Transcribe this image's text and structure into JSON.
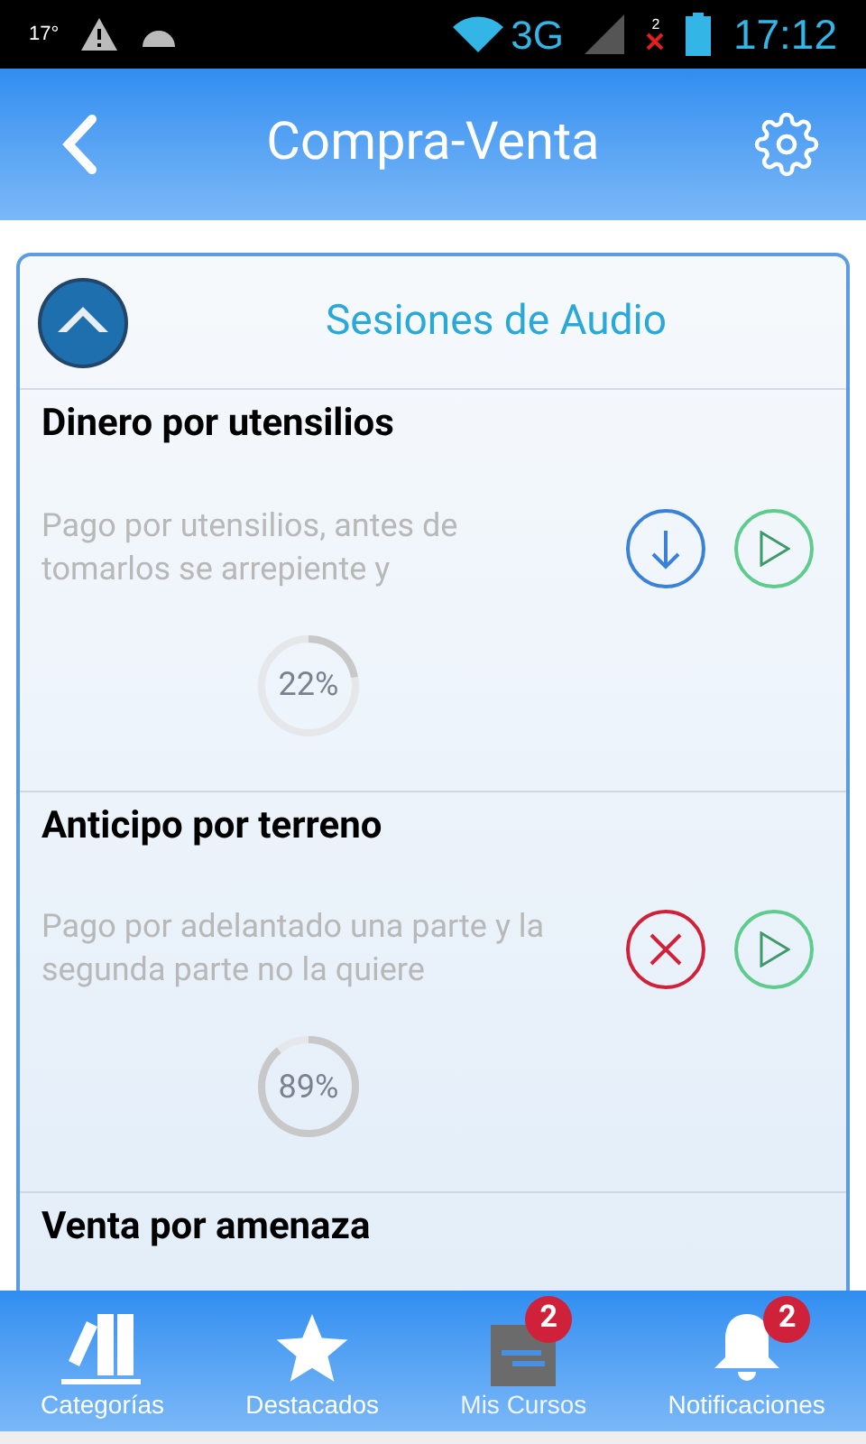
{
  "status_bar": {
    "temperature": "17°",
    "network": "3G",
    "sim_count": "2",
    "time": "17:12"
  },
  "header": {
    "title": "Compra-Venta"
  },
  "card": {
    "title": "Sesiones de Audio"
  },
  "sessions": [
    {
      "title": "Dinero por utensilios",
      "description": "Pago por utensilios, antes de tomarlos se arrepiente y",
      "kind": "download",
      "level": 0.22,
      "reading": "22%"
    },
    {
      "title": "Anticipo por terreno",
      "description": "Pago por adelantado una parte y la segunda parte no la quiere",
      "kind": "cancel",
      "level": 0.89,
      "reading": "89%"
    },
    {
      "title": "Venta por amenaza"
    }
  ],
  "nav": [
    {
      "kind": "categories",
      "label": "Categorías",
      "selected": false
    },
    {
      "kind": "featured",
      "label": "Destacados",
      "selected": false
    },
    {
      "kind": "courses",
      "label": "Mis Cursos",
      "selected": true,
      "badge": "2"
    },
    {
      "kind": "notifications",
      "label": "Notificaciones",
      "selected": false,
      "badge": "2"
    }
  ]
}
